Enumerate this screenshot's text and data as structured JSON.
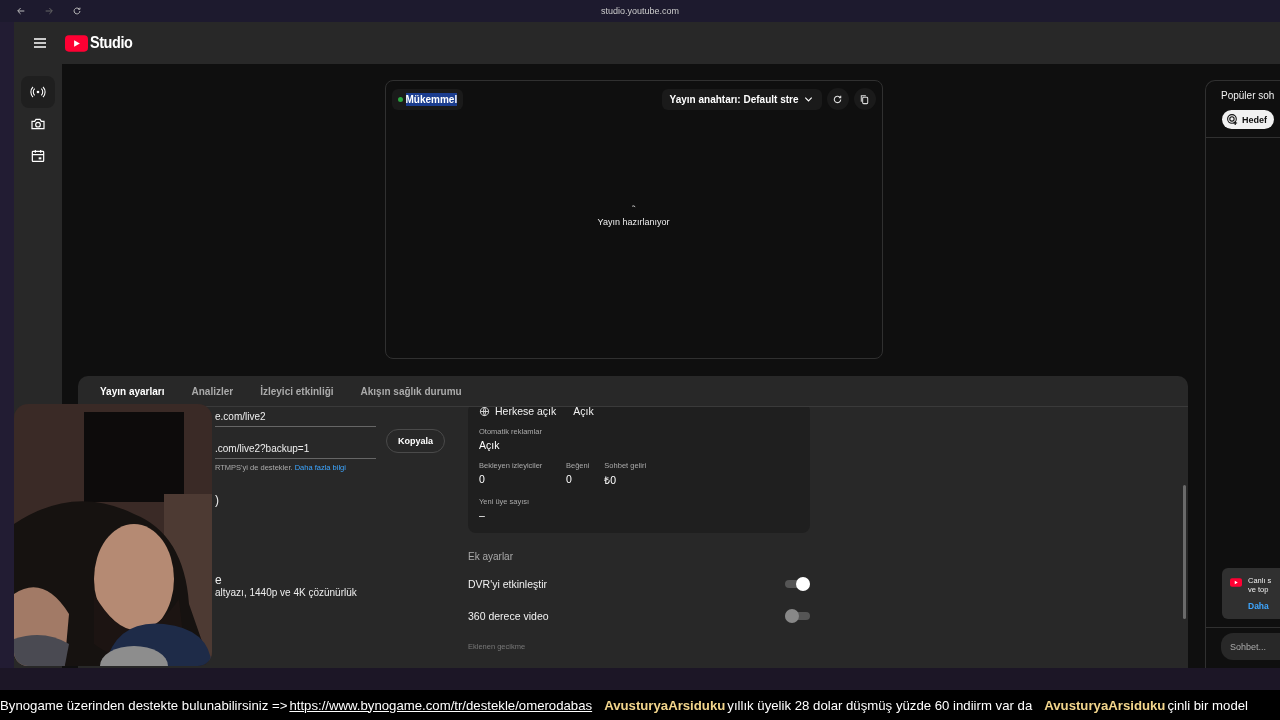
{
  "browser": {
    "url": "studio.youtube.com"
  },
  "header": {
    "logo": "Studio"
  },
  "sidebar": {
    "items": [
      {
        "kind": "live",
        "selected": true
      },
      {
        "kind": "camera",
        "selected": false
      },
      {
        "kind": "calendar",
        "selected": false
      }
    ]
  },
  "preview": {
    "status": "Mükemmel",
    "stream_key": "Yayın anahtarı: Default stre",
    "message": "Yayın hazırlanıyor"
  },
  "tabs": [
    {
      "label": "Yayın ayarları",
      "selected": true
    },
    {
      "label": "Analizler",
      "selected": false
    },
    {
      "label": "İzleyici etkinliği",
      "selected": false
    },
    {
      "label": "Akışın sağlık durumu",
      "selected": false
    }
  ],
  "settings": {
    "fields": [
      {
        "value": "e.com/live2"
      },
      {
        "value": ".com/live2?backup=1",
        "button": "Kopyala"
      }
    ],
    "help": "RTMPS'yi de destekler.",
    "help_link": "Daha fazla bilgi",
    "fragments": [
      {
        "kind": "title",
        "text": ")"
      },
      {
        "kind": "title",
        "text": "e"
      },
      {
        "kind": "text",
        "text": "altyazı, 1440p ve 4K çözünürlük"
      }
    ]
  },
  "summary": {
    "visibility": "Herkese açık",
    "visibility_value": "Açık",
    "ads": {
      "label": "Otomatik reklamlar",
      "value": "Açık"
    },
    "stats": [
      {
        "label": "Bekleyen izleyiciler",
        "value": "0"
      },
      {
        "label": "Beğeni",
        "value": "0"
      },
      {
        "label": "Sohbet geliri",
        "value": "₺0"
      }
    ],
    "members": {
      "label": "Yeni üye sayısı",
      "value": "–"
    }
  },
  "extra": {
    "title": "Ek ayarlar",
    "toggles": [
      {
        "label": "DVR'yi etkinleştir",
        "on": true
      },
      {
        "label": "360 derece video",
        "on": false
      }
    ],
    "delay_label": "Eklenen gecikme"
  },
  "chat": {
    "title": "Popüler soh",
    "chip": "Hedef",
    "notice": {
      "lines": [
        "Canlı s",
        "ve top"
      ],
      "link": "Daha"
    },
    "placeholder": "Sohbet..."
  },
  "ticker": [
    {
      "kind": "text",
      "text": "Bynogame üzerinden destekte bulunabilirsiniz =>"
    },
    {
      "kind": "link",
      "text": "https://www.bynogame.com/tr/destekle/omerodabas"
    },
    {
      "kind": "user",
      "text": "AvusturyaArsiduku"
    },
    {
      "kind": "text",
      "text": "yıllık üyelik 28 dolar düşmüş yüzde 60 indiirm var da"
    },
    {
      "kind": "user",
      "text": "AvusturyaArsiduku"
    },
    {
      "kind": "text",
      "text": "çinli bir model"
    }
  ]
}
